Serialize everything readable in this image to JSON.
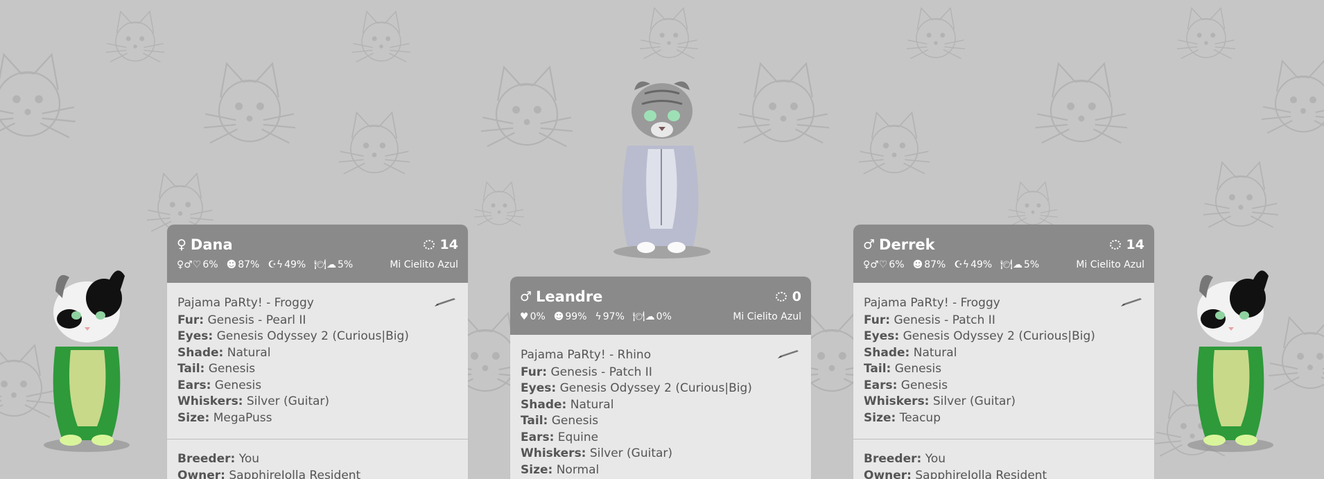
{
  "cards": [
    {
      "gender_symbol": "♀",
      "name": "Dana",
      "generation": "14",
      "stats": {
        "breed_icon": "♀♂♡",
        "breed": "6%",
        "happy_icon": "☻",
        "happy": "87%",
        "energy_icon": "☪ϟ",
        "energy": "49%",
        "hunger_icon": "🍽☁",
        "hunger": "5%"
      },
      "sim": "Mi Cielito Azul",
      "collection": "Pajama PaRty! - Froggy",
      "traits": [
        {
          "label": "Fur:",
          "value": "Genesis - Pearl II"
        },
        {
          "label": "Eyes:",
          "value": "Genesis Odyssey 2 (Curious|Big)"
        },
        {
          "label": "Shade:",
          "value": "Natural"
        },
        {
          "label": "Tail:",
          "value": "Genesis"
        },
        {
          "label": "Ears:",
          "value": "Genesis"
        },
        {
          "label": "Whiskers:",
          "value": "Silver (Guitar)"
        },
        {
          "label": "Size:",
          "value": "MegaPuss"
        }
      ],
      "breeder_label": "Breeder:",
      "breeder": "You",
      "owner_label": "Owner:",
      "owner": "SapphireJolla Resident"
    },
    {
      "gender_symbol": "♂",
      "name": "Leandre",
      "generation": "0",
      "stats": {
        "breed_icon": "♥",
        "breed": "0%",
        "happy_icon": "☻",
        "happy": "99%",
        "energy_icon": "ϟ",
        "energy": "97%",
        "hunger_icon": "🍽☁",
        "hunger": "0%"
      },
      "sim": "Mi Cielito Azul",
      "collection": "Pajama PaRty! - Rhino",
      "traits": [
        {
          "label": "Fur:",
          "value": "Genesis - Patch II"
        },
        {
          "label": "Eyes:",
          "value": "Genesis Odyssey 2 (Curious|Big)"
        },
        {
          "label": "Shade:",
          "value": "Natural"
        },
        {
          "label": "Tail:",
          "value": "Genesis"
        },
        {
          "label": "Ears:",
          "value": "Equine"
        },
        {
          "label": "Whiskers:",
          "value": "Silver (Guitar)"
        },
        {
          "label": "Size:",
          "value": "Normal"
        }
      ]
    },
    {
      "gender_symbol": "♂",
      "name": "Derrek",
      "generation": "14",
      "stats": {
        "breed_icon": "♀♂♡",
        "breed": "6%",
        "happy_icon": "☻",
        "happy": "87%",
        "energy_icon": "☪ϟ",
        "energy": "49%",
        "hunger_icon": "🍽☁",
        "hunger": "5%"
      },
      "sim": "Mi Cielito Azul",
      "collection": "Pajama PaRty! - Froggy",
      "traits": [
        {
          "label": "Fur:",
          "value": "Genesis - Patch II"
        },
        {
          "label": "Eyes:",
          "value": "Genesis Odyssey 2 (Curious|Big)"
        },
        {
          "label": "Shade:",
          "value": "Natural"
        },
        {
          "label": "Tail:",
          "value": "Genesis"
        },
        {
          "label": "Ears:",
          "value": "Genesis"
        },
        {
          "label": "Whiskers:",
          "value": "Silver (Guitar)"
        },
        {
          "label": "Size:",
          "value": "Teacup"
        }
      ],
      "breeder_label": "Breeder:",
      "breeder": "You",
      "owner_label": "Owner:",
      "owner": "SapphireJolla Resident"
    }
  ],
  "colors": {
    "background": "#c6c6c6",
    "card_header": "#8a8a8a",
    "card_body": "#e8e8e8",
    "frog_suit": "#2e9a3a",
    "frog_belly": "#c8d98a",
    "rhino_suit": "#b9bccf"
  },
  "icons": [
    "cat-pattern-icon",
    "generation-icon",
    "edit-pencil-icon"
  ]
}
